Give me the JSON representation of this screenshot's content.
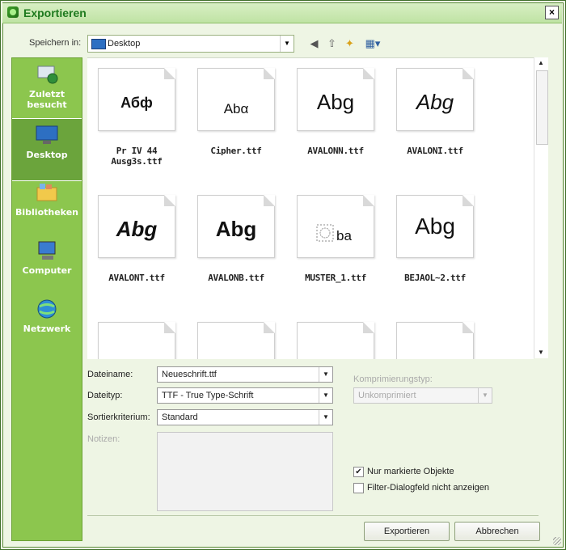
{
  "window": {
    "title": "Exportieren",
    "close": "×"
  },
  "location": {
    "label": "Speichern in:",
    "value": "Desktop"
  },
  "places": [
    {
      "label": "Zuletzt besucht",
      "icon": "recent-places-icon"
    },
    {
      "label": "Desktop",
      "icon": "desktop-icon"
    },
    {
      "label": "Bibliotheken",
      "icon": "libraries-icon"
    },
    {
      "label": "Computer",
      "icon": "computer-icon"
    },
    {
      "label": "Netzwerk",
      "icon": "network-icon"
    }
  ],
  "files": [
    {
      "name": "Pr IV 44 Ausg3s.ttf",
      "sample": "Абф"
    },
    {
      "name": "Cipher.ttf",
      "sample": "Abα"
    },
    {
      "name": "AVALONN.ttf",
      "sample": "Abg"
    },
    {
      "name": "AVALONI.ttf",
      "sample": "Abg"
    },
    {
      "name": "AVALONT.ttf",
      "sample": "Abg"
    },
    {
      "name": "AVALONB.ttf",
      "sample": "Abg"
    },
    {
      "name": "MUSTER_1.ttf",
      "sample": "ba"
    },
    {
      "name": "BEJAOL~2.ttf",
      "sample": "Abg"
    }
  ],
  "form": {
    "filename_label": "Dateiname:",
    "filename_value": "Neueschrift.ttf",
    "filetype_label": "Dateityp:",
    "filetype_value": "TTF - True Type-Schrift",
    "sort_label": "Sortierkriterium:",
    "sort_value": "Standard",
    "notes_label": "Notizen:",
    "compression_label": "Komprimierungstyp:",
    "compression_value": "Unkomprimiert",
    "only_selected_label": "Nur markierte Objekte",
    "only_selected_checked": true,
    "no_filter_dialog_label": "Filter-Dialogfeld nicht anzeigen",
    "no_filter_dialog_checked": false
  },
  "buttons": {
    "export": "Exportieren",
    "cancel": "Abbrechen"
  },
  "colors": {
    "accent": "#8cc64e",
    "title": "#1e7a1e"
  }
}
